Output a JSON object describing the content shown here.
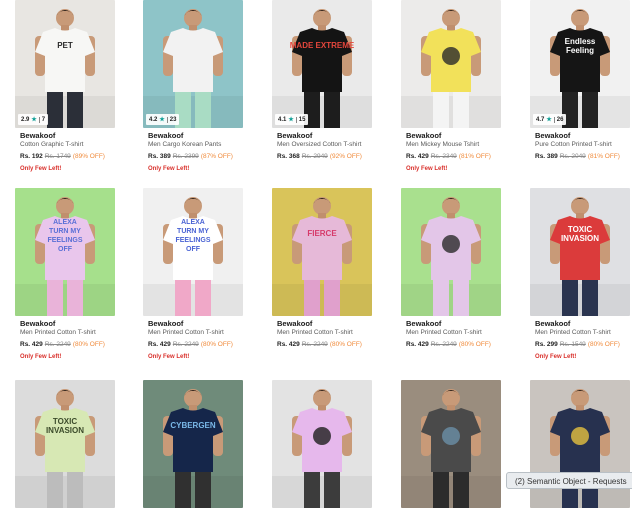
{
  "products": [
    {
      "brand": "Bewakoof",
      "title": "Cotton Graphic T-shirt",
      "price": "Rs. 192",
      "mrp": "Rs. 1749",
      "off": "(89% OFF)",
      "few": "Only Few Left!",
      "rating": "2.9",
      "reviews": "7",
      "bg": "#e8e6e2",
      "shirt": "#f7f7f5",
      "pants": "#2b2f38",
      "print": "#2a2a2a"
    },
    {
      "brand": "Bewakoof",
      "title": "Men Cargo Korean Pants",
      "price": "Rs. 389",
      "mrp": "Rs. 2399",
      "off": "(87% OFF)",
      "few": "Only Few Left!",
      "rating": "4.2",
      "reviews": "23",
      "bg": "#8ec4c8",
      "shirt": "#f2f2f2",
      "pants": "#a9dcc4",
      "print": ""
    },
    {
      "brand": "Bewakoof",
      "title": "Men Oversized Cotton T-shirt",
      "price": "Rs. 368",
      "mrp": "Rs. 2949",
      "off": "(92% OFF)",
      "few": "",
      "rating": "4.1",
      "reviews": "15",
      "bg": "#eaeaea",
      "shirt": "#141414",
      "pants": "#1d1d1d",
      "print": "#e4463c"
    },
    {
      "brand": "Bewakoof",
      "title": "Men Mickey Mouse Tshirt",
      "price": "Rs. 429",
      "mrp": "Rs. 2349",
      "off": "(81% OFF)",
      "few": "Only Few Left!",
      "rating": "",
      "reviews": "",
      "bg": "#ecebea",
      "shirt": "#f2e15a",
      "pants": "#f4f4f4",
      "print": "#2a2a2a"
    },
    {
      "brand": "Bewakoof",
      "title": "Pure Cotton Printed T-shirt",
      "price": "Rs. 389",
      "mrp": "Rs. 2049",
      "off": "(81% OFF)",
      "few": "",
      "rating": "4.7",
      "reviews": "26",
      "bg": "#f1f1f1",
      "shirt": "#151515",
      "pants": "#222222",
      "print": "#ffffff"
    },
    {
      "brand": "Bewakoof",
      "title": "Men Printed Cotton T-shirt",
      "price": "Rs. 429",
      "mrp": "Rs. 2249",
      "off": "(80% OFF)",
      "few": "Only Few Left!",
      "rating": "",
      "reviews": "",
      "bg": "#a6e08c",
      "shirt": "#e9c6ec",
      "pants": "#e9b3d9",
      "print": "#5a6fd6"
    },
    {
      "brand": "Bewakoof",
      "title": "Men Printed Cotton T-shirt",
      "price": "Rs. 429",
      "mrp": "Rs. 2249",
      "off": "(80% OFF)",
      "few": "Only Few Left!",
      "rating": "",
      "reviews": "",
      "bg": "#f0f0f0",
      "shirt": "#ffffff",
      "pants": "#f0a8c8",
      "print": "#4a63d4"
    },
    {
      "brand": "Bewakoof",
      "title": "Men Printed Cotton T-shirt",
      "price": "Rs. 429",
      "mrp": "Rs. 2249",
      "off": "(80% OFF)",
      "few": "",
      "rating": "",
      "reviews": "",
      "bg": "#d9c45a",
      "shirt": "#e6b9d8",
      "pants": "#e0a0cc",
      "print": "#d63a6a"
    },
    {
      "brand": "Bewakoof",
      "title": "Men Printed Cotton T-shirt",
      "price": "Rs. 429",
      "mrp": "Rs. 2249",
      "off": "(80% OFF)",
      "few": "",
      "rating": "",
      "reviews": "",
      "bg": "#a9e08e",
      "shirt": "#e3c6e8",
      "pants": "#e3c6e8",
      "print": "#2a2a2a"
    },
    {
      "brand": "Bewakoof",
      "title": "Men Printed Cotton T-shirt",
      "price": "Rs. 299",
      "mrp": "Rs. 1549",
      "off": "(80% OFF)",
      "few": "Only Few Left!",
      "rating": "",
      "reviews": "",
      "bg": "#dfe0e3",
      "shirt": "#db3b3b",
      "pants": "#2b3550",
      "print": "#ffffff"
    },
    {
      "brand": "",
      "title": "",
      "price": "",
      "mrp": "",
      "off": "",
      "few": "",
      "rating": "",
      "reviews": "",
      "bg": "#dcdcdc",
      "shirt": "#d7e8b4",
      "pants": "#bcbcbc",
      "print": "#3b4b2a"
    },
    {
      "brand": "",
      "title": "",
      "price": "",
      "mrp": "",
      "off": "",
      "few": "",
      "rating": "",
      "reviews": "",
      "bg": "#6f8b7a",
      "shirt": "#15264a",
      "pants": "#303030",
      "print": "#7ab8e8"
    },
    {
      "brand": "",
      "title": "",
      "price": "",
      "mrp": "",
      "off": "",
      "few": "",
      "rating": "",
      "reviews": "",
      "bg": "#e3e3e3",
      "shirt": "#e6b8ec",
      "pants": "#3c3c3c",
      "print": "#1e1e1e"
    },
    {
      "brand": "",
      "title": "",
      "price": "",
      "mrp": "",
      "off": "",
      "few": "",
      "rating": "",
      "reviews": "",
      "bg": "#9a8d7e",
      "shirt": "#4a4a4a",
      "pants": "#2c2c2c",
      "print": "#6a8ea6"
    },
    {
      "brand": "",
      "title": "",
      "price": "",
      "mrp": "",
      "off": "",
      "few": "",
      "rating": "",
      "reviews": "",
      "bg": "#c9c4bf",
      "shirt": "#27314f",
      "pants": "#27314f",
      "print": "#e6c23e"
    }
  ],
  "print_text": {
    "p1": "PET",
    "p3": "MADE EXTREME",
    "p5a": "Endless",
    "p5b": "Feeling",
    "p6a": "ALEXA",
    "p6b": "TURN MY",
    "p6c": "FEELINGS",
    "p6d": "OFF",
    "p8": "FIERCE",
    "p10a": "TOXIC",
    "p10b": "INVASION",
    "p11a": "TOXIC",
    "p11b": "INVASION",
    "p12": "CYBERGEN"
  },
  "toast": {
    "text": "(2) Semantic Object - Requests"
  },
  "colors": {
    "offer": "#f08a3a",
    "alert": "#d9302b",
    "rating_star": "#0e9e95"
  }
}
